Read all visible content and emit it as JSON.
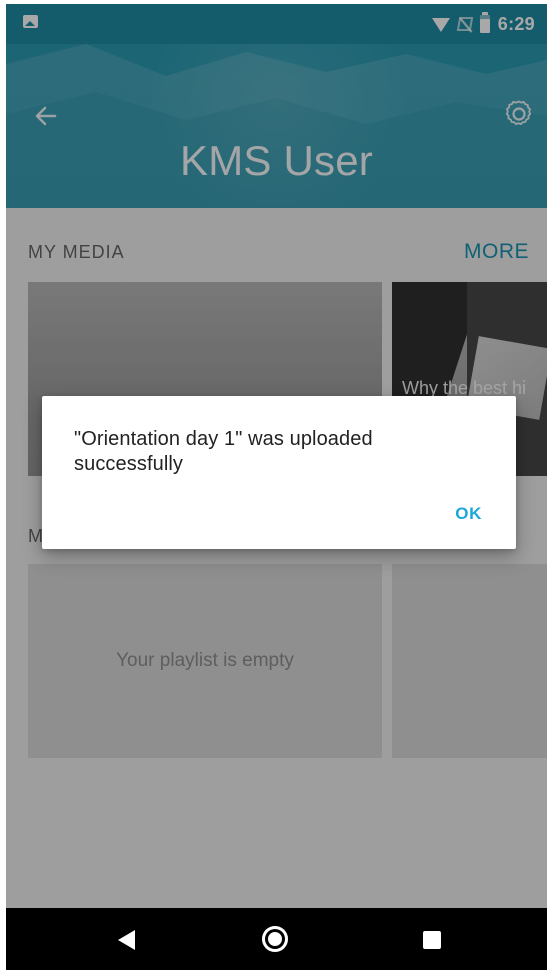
{
  "status_bar": {
    "time": "6:29"
  },
  "header": {
    "title": "KMS User"
  },
  "sections": {
    "my_media": {
      "title": "MY MEDIA",
      "more_label": "MORE"
    },
    "second_section": {
      "title_visible": "M"
    }
  },
  "media_tiles": [
    {
      "title_visible": ""
    },
    {
      "title_visible": "Why the best hi\nesu"
    }
  ],
  "playlist": {
    "empty_message": "Your playlist is empty"
  },
  "dialog": {
    "message": "\"Orientation day 1\" was uploaded successfully",
    "ok_label": "OK"
  },
  "icons": {
    "status_left": "photo-icon",
    "wifi": "wifi-icon",
    "no_sim": "no-sim-icon",
    "battery": "battery-icon",
    "back": "back-arrow-icon",
    "settings": "gear-icon",
    "nav_back": "nav-back-icon",
    "nav_home": "nav-home-icon",
    "nav_recents": "nav-recents-icon"
  },
  "colors": {
    "header_teal": "#2a98b0",
    "accent_blue": "#1c92b1",
    "dialog_button": "#1ca7d7"
  }
}
